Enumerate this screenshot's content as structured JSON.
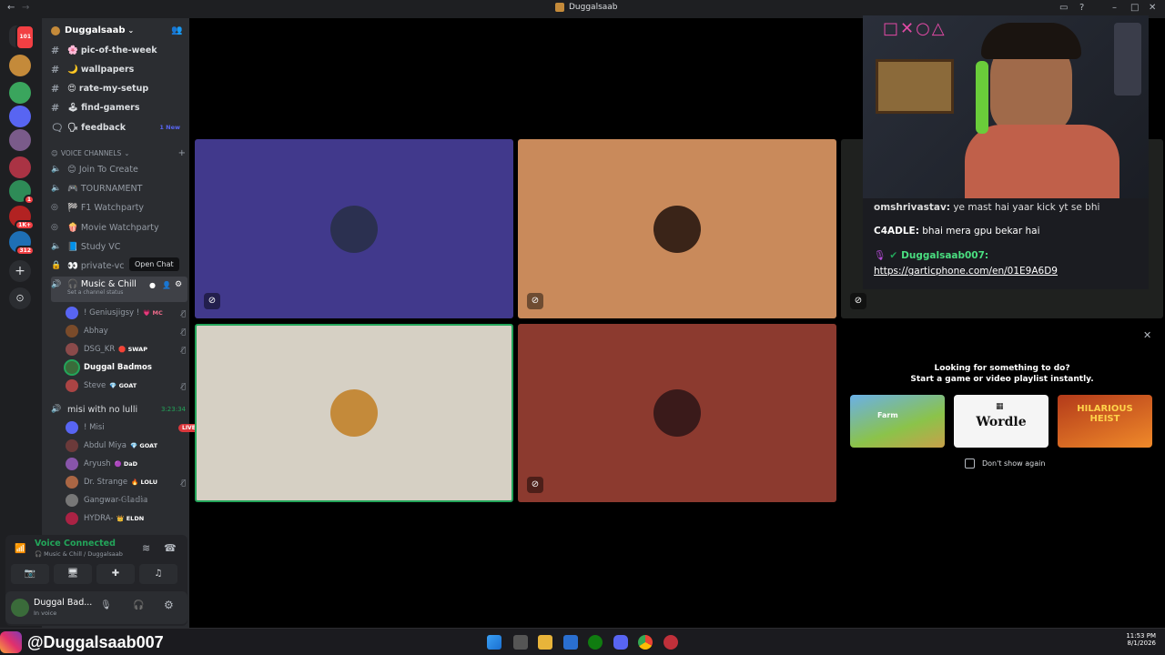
{
  "window": {
    "title": "Duggalsaab"
  },
  "rail": {
    "home_badge": "101",
    "badges": [
      "1",
      "1K+",
      "312"
    ]
  },
  "server": {
    "name": "Duggalsaab",
    "chevron": "chevron-down-icon"
  },
  "text_channels": [
    {
      "emoji": "🌸",
      "name": "pic-of-the-week",
      "badge": ""
    },
    {
      "emoji": "🌙",
      "name": "wallpapers",
      "badge": ""
    },
    {
      "emoji": "😍",
      "name": "rate-my-setup",
      "badge": ""
    },
    {
      "emoji": "🕹",
      "name": "find-gamers",
      "badge": ""
    },
    {
      "emoji": "🗣",
      "name": "feedback",
      "badge": "1 New"
    }
  ],
  "voice_header": "VOICE CHANNELS",
  "voice_channels": [
    {
      "emoji": "😊",
      "name": "Join To Create"
    },
    {
      "emoji": "🎮",
      "name": "TOURNAMENT"
    },
    {
      "emoji": "🏁",
      "name": "F1 Watchparty"
    },
    {
      "emoji": "🍿",
      "name": "Movie Watchparty"
    },
    {
      "emoji": "📘",
      "name": "Study VC"
    },
    {
      "emoji": "👀",
      "name": "private-vc"
    }
  ],
  "active_channel": {
    "name": "🎧 Music & Chill",
    "status": "Set a channel status",
    "tooltip": "Open Chat"
  },
  "members_music": [
    {
      "name": "! Geniusjigsy !",
      "tag": "💗 MC",
      "color": "#5865f2"
    },
    {
      "name": "Abhay",
      "tag": "",
      "color": "#7a4b2a"
    },
    {
      "name": "DSG_KR",
      "tag": "🛑 SWAP",
      "color": "#8a4a4a"
    },
    {
      "name": "Duggal Badmos",
      "tag": "",
      "color": "#3a6b3a"
    },
    {
      "name": "Steve",
      "tag": "💎 GOAT",
      "color": "#aa4444"
    }
  ],
  "channel2": {
    "name": "misi with no lulli",
    "time": "3:23:34"
  },
  "members_misi": [
    {
      "name": "! Misi",
      "tag": "LIVE",
      "color": "#5865f2"
    },
    {
      "name": "Abdul Miya",
      "tag": "💎 GOAT",
      "color": "#6b3a3a"
    },
    {
      "name": "Aryush",
      "tag": "🟣 DaD",
      "color": "#8855aa"
    },
    {
      "name": "Dr. Strange",
      "tag": "🔥 LOLU",
      "color": "#aa6644"
    },
    {
      "name": "Gangwar⁠-⁠𝔾𝕝𝕒𝕕𝕚𝕒",
      "tag": "",
      "color": "#777777"
    },
    {
      "name": "HYDRA⁠-⁠",
      "tag": "👑 ELDN",
      "color": "#aa2244"
    }
  ],
  "voice_panel": {
    "status": "Voice Connected",
    "location": "🎧 Music & Chill / Duggalsaab"
  },
  "user": {
    "name": "Duggal Bad...",
    "status": "In voice"
  },
  "tiles": [
    {
      "bg": "#41398c",
      "avatar": "#2b3050"
    },
    {
      "bg": "#c98a5b",
      "avatar": "#3a2418"
    },
    {
      "bg": "#d6d0c4",
      "avatar": "#c48a3a"
    },
    {
      "bg": "#8c3a2f",
      "avatar": "#3a1a1a"
    }
  ],
  "chat": [
    {
      "user": "omshrivastav:",
      "text": "ye mast hai yaar kick yt se bhi"
    },
    {
      "user": "C4ADLE:",
      "text": "bhai mera gpu bekar hai"
    },
    {
      "user": "Duggalsaab007:",
      "text": ""
    },
    {
      "user": "",
      "text": "https://garticphone.com/en/01E9A6D9"
    }
  ],
  "suggestions": {
    "title": "Looking for something to do?",
    "subtitle": "Start a game or video playlist instantly.",
    "games": [
      "Farm",
      "Wordle",
      "HILARIOUS HEIST"
    ],
    "dont_show": "Don't show again"
  },
  "overlay": {
    "handle": "@Duggalsaab007"
  },
  "clock": {
    "time": "11:53 PM",
    "date": "8/1/2026"
  }
}
